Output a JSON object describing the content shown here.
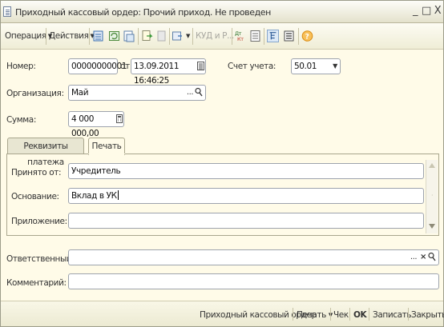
{
  "window": {
    "title": "Приходный кассовый ордер: Прочий приход. Не проведен",
    "minimize": "_",
    "maximize": "□",
    "close": "X"
  },
  "toolbar": {
    "operation_label": "Операция",
    "actions_label": "Действия",
    "kudir_label": "КУД и Р..."
  },
  "form": {
    "number_label": "Номер:",
    "number_value": "00000000001",
    "from_label": "от:",
    "date_value": "13.09.2011 16:46:25",
    "account_label": "Счет учета:",
    "account_value": "50.01",
    "org_label": "Организация:",
    "org_value": "Май",
    "sum_label": "Сумма:",
    "sum_value": "4 000 000,00",
    "responsible_label": "Ответственный:",
    "responsible_value": "",
    "comment_label": "Комментарий:",
    "comment_value": ""
  },
  "tabs": {
    "items": [
      {
        "label": "Реквизиты платежа",
        "active": false
      },
      {
        "label": "Печать",
        "active": true
      }
    ]
  },
  "print_tab": {
    "accepted_from_label": "Принято от:",
    "accepted_from_value": "Учредитель",
    "basis_label": "Основание:",
    "basis_value": "Вклад в УК",
    "attachment_label": "Приложение:",
    "attachment_value": ""
  },
  "statusbar": {
    "pko_label": "Приходный кассовый ордер",
    "print_label": "Печать",
    "check_label": "Чек",
    "ok_label": "OK",
    "save_label": "Записать",
    "close_label": "Закрыть"
  },
  "icons": [
    "document-icon",
    "list-icon",
    "refresh-icon",
    "print-icon",
    "copy-icon",
    "move-icon",
    "debit-credit-icon",
    "report-icon",
    "filter-icon",
    "structure-icon",
    "help-icon",
    "calendar-icon",
    "calculator-icon",
    "search-icon",
    "clear-icon",
    "dropdown-icon"
  ],
  "colors": {
    "accent": "#3a6fb0",
    "help": "#f0a020",
    "window_bg": "#fffbe8"
  }
}
